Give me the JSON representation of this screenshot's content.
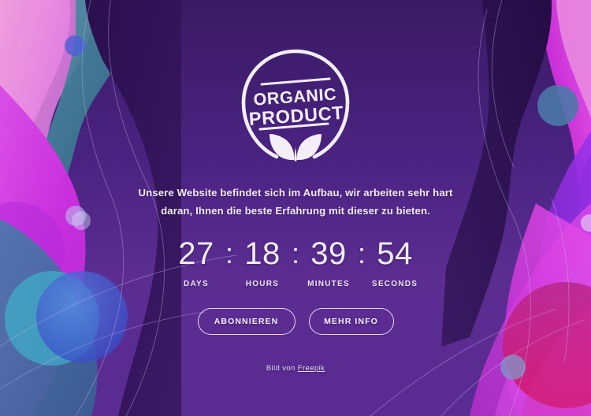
{
  "page": {
    "background_color": "#5b2d91",
    "theme_colors": {
      "deep_purple": "#3a1a63",
      "mid_purple": "#5b2d91",
      "magenta": "#cc2fd8",
      "pink": "#e88fd8",
      "crimson": "#d4176b",
      "violet": "#8b2ede",
      "teal": "#3c8fa6",
      "steel_blue": "#41689e",
      "text_white": "#f4eef9"
    }
  },
  "logo": {
    "name": "organic-product-badge",
    "line1": "ORGANIC",
    "line2": "PRODUCT",
    "icon": "leaf-icon",
    "color": "#f4eef9"
  },
  "headline": {
    "text": "Unsere Website befindet sich im Aufbau, wir arbeiten sehr hart daran, Ihnen die beste Erfahrung mit dieser zu bieten."
  },
  "countdown": {
    "separator": ":",
    "units": [
      {
        "value": "27",
        "label": "DAYS"
      },
      {
        "value": "18",
        "label": "HOURS"
      },
      {
        "value": "39",
        "label": "MINUTES"
      },
      {
        "value": "54",
        "label": "SECONDS"
      }
    ]
  },
  "buttons": {
    "subscribe_label": "ABONNIEREN",
    "more_info_label": "MEHR INFO"
  },
  "credit": {
    "prefix": "Bild von ",
    "link_label": "Freepik"
  }
}
